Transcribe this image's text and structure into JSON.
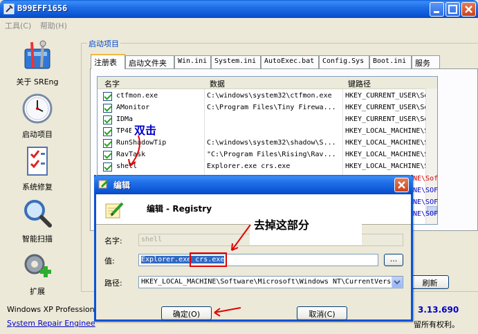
{
  "window": {
    "title": "B99EFF1656",
    "icon": "wrench-app-icon"
  },
  "menu": {
    "items": [
      "工具(C)",
      "帮助(H)"
    ]
  },
  "nav": [
    {
      "label": "关于 SREng",
      "icon": "about-toolbox-icon"
    },
    {
      "label": "启动项目",
      "icon": "clock-icon"
    },
    {
      "label": "系统修复",
      "icon": "checklist-icon"
    },
    {
      "label": "智能扫描",
      "icon": "magnifier-icon"
    },
    {
      "label": "扩展",
      "icon": "gear-plus-icon"
    }
  ],
  "group": {
    "title": "启动项目"
  },
  "tabs": [
    "注册表",
    "启动文件夹",
    "Win.ini",
    "System.ini",
    "AutoExec.bat",
    "Config.Sys",
    "Boot.ini",
    "服务"
  ],
  "list": {
    "columns": [
      "名字",
      "数据",
      "键路径"
    ],
    "rows": [
      {
        "name": "ctfmon.exe",
        "data": "C:\\windows\\system32\\ctfmon.exe",
        "key": "HKEY_CURRENT_USER\\Soft"
      },
      {
        "name": "AMonitor",
        "data": "C:\\Program Files\\Tiny Firewa...",
        "key": "HKEY_CURRENT_USER\\Soft"
      },
      {
        "name": "IDMa",
        "data": "",
        "key": "HKEY_CURRENT_USER\\Soft"
      },
      {
        "name": "TP4E",
        "data": "",
        "key": "HKEY_LOCAL_MACHINE\\Sof"
      },
      {
        "name": "RunShadowTip",
        "data": "C:\\windows\\system32\\shadow\\S...",
        "key": "HKEY_LOCAL_MACHINE\\Sof"
      },
      {
        "name": "RavTask",
        "data": "\"C:\\Program Files\\Rising\\Rav...",
        "key": "HKEY_LOCAL_MACHINE\\Sof"
      },
      {
        "name": "shell",
        "data": "Explorer.exe crs.exe",
        "key": "HKEY_LOCAL_MACHINE\\Sof"
      }
    ],
    "hidden_keys": [
      "NE\\Sof",
      "NE\\SOF",
      "NE\\SOF",
      "NE\\SOF"
    ]
  },
  "right_button": "刷新",
  "footer": {
    "line1": "Windows XP Profession",
    "line2": "System Repair Enginee",
    "version": "3.13.690",
    "copyright": "留所有权利。"
  },
  "dialog": {
    "title": "编辑",
    "header": "编辑 - Registry",
    "name_label": "名字:",
    "name_value": "shell",
    "value_label": "值:",
    "value_text": "Explorer.exe crs.exe",
    "value_selected": "Explorer.exe",
    "value_rest": " crs.exe",
    "browse_label": "...",
    "path_label": "路径:",
    "path_value": "HKEY_LOCAL_MACHINE\\Software\\Microsoft\\Windows NT\\CurrentVers",
    "ok_label": "确定(O)",
    "cancel_label": "取消(C)"
  },
  "annotations": {
    "double_click": "双击",
    "remove_part": "去掉这部分"
  },
  "colors": {
    "titlebar": "#0b55d3",
    "annotation_red": "#e00000",
    "annotation_blue": "#0000c8"
  }
}
